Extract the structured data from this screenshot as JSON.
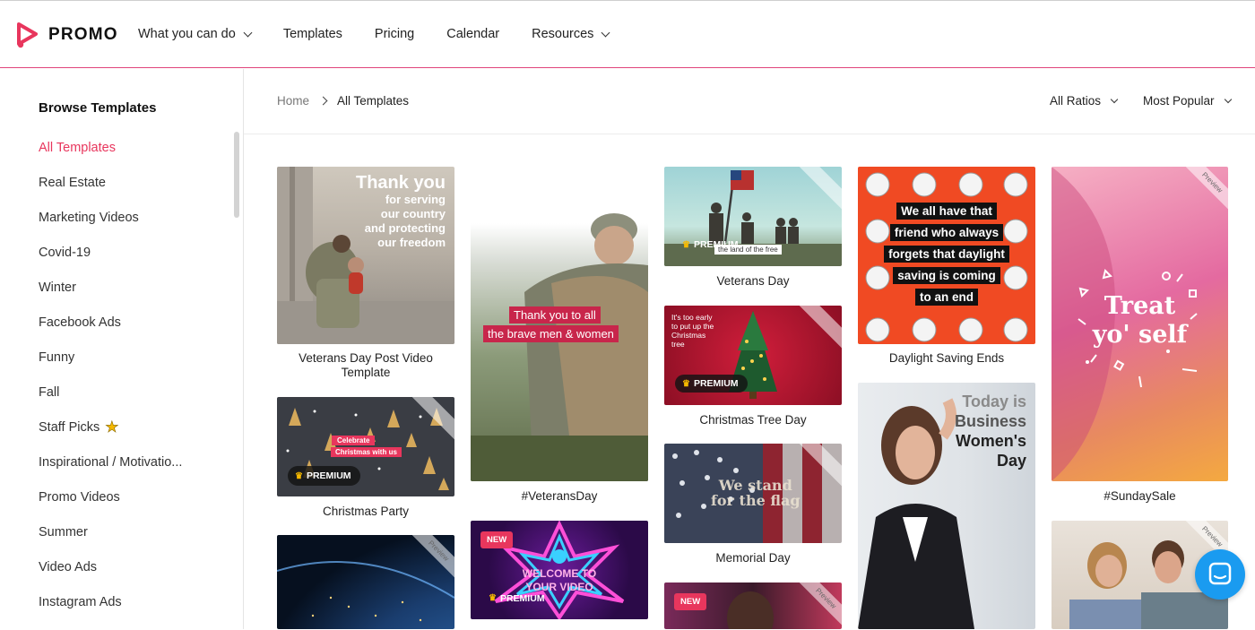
{
  "brand": {
    "name": "PROMO",
    "accent": "#e8365d"
  },
  "nav": [
    {
      "label": "What you can do",
      "has_dropdown": true
    },
    {
      "label": "Templates",
      "has_dropdown": false
    },
    {
      "label": "Pricing",
      "has_dropdown": false
    },
    {
      "label": "Calendar",
      "has_dropdown": false
    },
    {
      "label": "Resources",
      "has_dropdown": true
    }
  ],
  "sidebar": {
    "title": "Browse Templates",
    "items": [
      {
        "label": "All Templates",
        "active": true
      },
      {
        "label": "Real Estate"
      },
      {
        "label": "Marketing Videos"
      },
      {
        "label": "Covid-19"
      },
      {
        "label": "Winter"
      },
      {
        "label": "Facebook Ads"
      },
      {
        "label": "Funny"
      },
      {
        "label": "Fall"
      },
      {
        "label": "Staff Picks",
        "icon": "star-icon"
      },
      {
        "label": "Inspirational / Motivatio..."
      },
      {
        "label": "Promo Videos"
      },
      {
        "label": "Summer"
      },
      {
        "label": "Video Ads"
      },
      {
        "label": "Instagram Ads"
      }
    ]
  },
  "breadcrumb": {
    "home": "Home",
    "current": "All Templates"
  },
  "filters": {
    "ratio": "All Ratios",
    "sort": "Most Popular"
  },
  "templates": [
    {
      "caption": "Veterans Day Post Video Template",
      "overlay": [
        "Thank you",
        "for serving",
        "our country",
        "and protecting",
        "our freedom"
      ]
    },
    {
      "caption": "Christmas Party",
      "badge": "PREMIUM",
      "overlay": [
        "Celebrate",
        "Christmas with us"
      ]
    },
    {
      "caption": "",
      "ribbon": "Preview"
    },
    {
      "caption": "#VeteransDay",
      "overlay": [
        "Thank you to all",
        "the brave men & women"
      ]
    },
    {
      "caption": "",
      "new": "NEW",
      "badge": "PREMIUM",
      "overlay": [
        "WELCOME TO",
        "YOUR VIDEO"
      ]
    },
    {
      "caption": "Veterans Day",
      "badge": "PREMIUM",
      "overlay": [
        "the land of the free"
      ]
    },
    {
      "caption": "Christmas Tree Day",
      "badge": "PREMIUM",
      "overlay": [
        "It's too early",
        "to put up the",
        "Christmas",
        "tree"
      ]
    },
    {
      "caption": "Memorial Day",
      "overlay": [
        "We stand",
        "for the flag"
      ]
    },
    {
      "caption": "",
      "new": "NEW",
      "ribbon": "Preview"
    },
    {
      "caption": "Daylight Saving Ends",
      "overlay": [
        "We all have that",
        "friend who always",
        "forgets that daylight",
        "saving is coming",
        "to an end"
      ]
    },
    {
      "caption": "",
      "overlay": [
        "Today is",
        "Business",
        "Women's",
        "Day"
      ]
    },
    {
      "caption": "#SundaySale",
      "overlay": [
        "Treat",
        "yo' self"
      ],
      "ribbon": "Preview"
    },
    {
      "caption": "",
      "ribbon": "Preview"
    }
  ]
}
